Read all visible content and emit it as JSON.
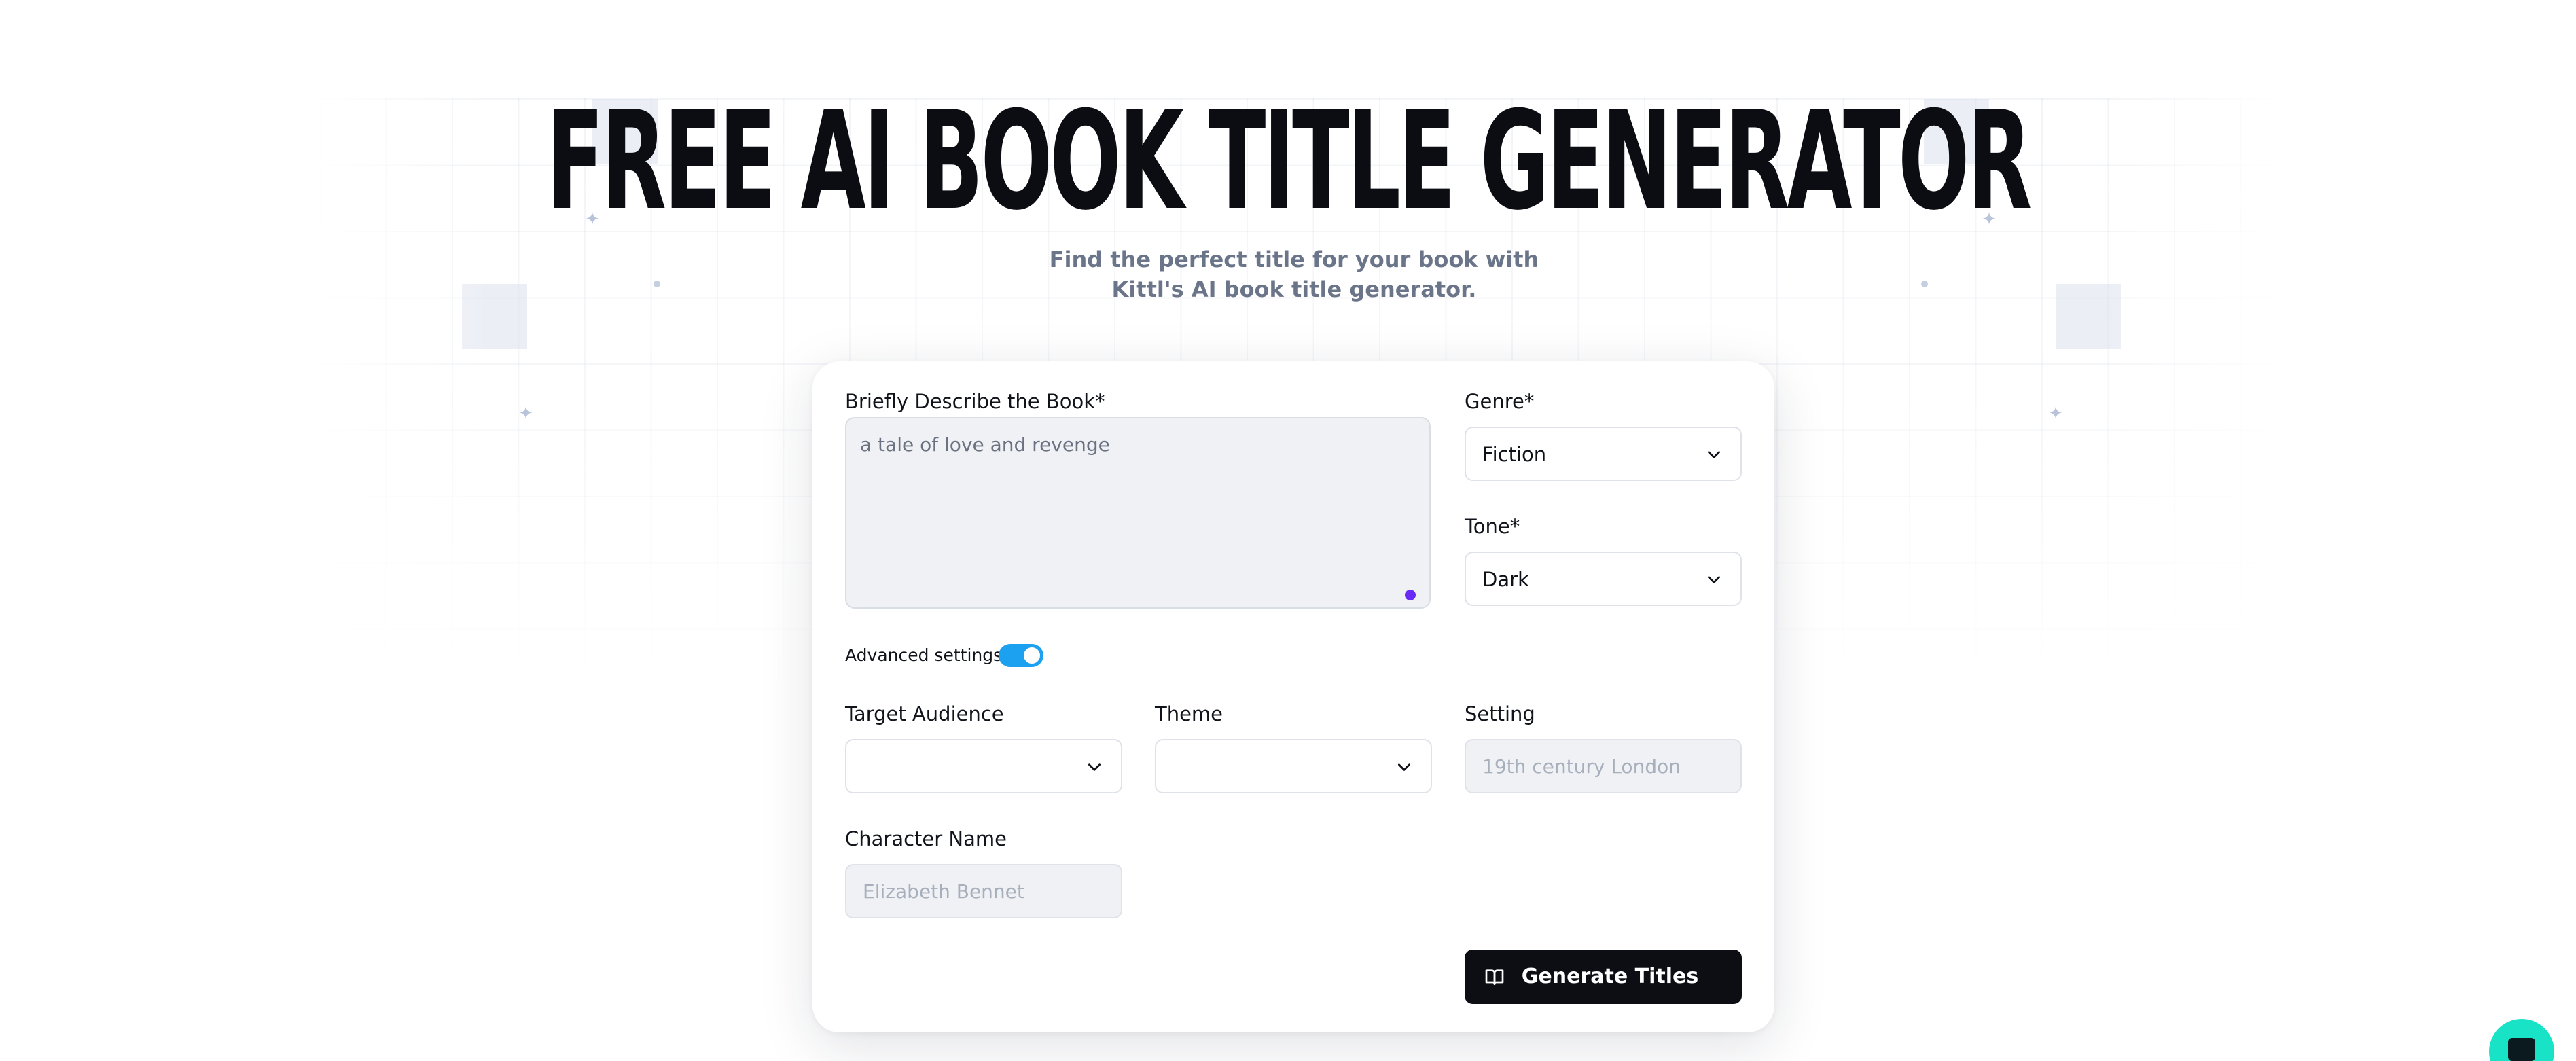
{
  "hero": {
    "title": "FREE AI BOOK TITLE GENERATOR",
    "subtitle_line1": "Find the perfect title for your book with",
    "subtitle_line2": "Kittl's AI book title generator."
  },
  "form": {
    "description": {
      "label": "Briefly Describe the Book*",
      "value": "a tale of love and revenge"
    },
    "genre": {
      "label": "Genre*",
      "value": "Fiction"
    },
    "tone": {
      "label": "Tone*",
      "value": "Dark"
    },
    "advanced": {
      "label": "Advanced settings",
      "enabled": true
    },
    "target_audience": {
      "label": "Target Audience",
      "value": ""
    },
    "theme": {
      "label": "Theme",
      "value": ""
    },
    "setting": {
      "label": "Setting",
      "placeholder": "19th century London"
    },
    "character_name": {
      "label": "Character Name",
      "placeholder": "Elizabeth Bennet"
    },
    "submit_label": "Generate Titles"
  },
  "colors": {
    "accent_toggle": "#1ca1f1",
    "primary_button": "#0c0e13",
    "chat_widget": "#18e3c7",
    "textarea_handle": "#6a2cf5"
  },
  "icons": {
    "chevron": "chevron-down-icon",
    "book": "book-open-icon",
    "chat": "chat-icon"
  }
}
